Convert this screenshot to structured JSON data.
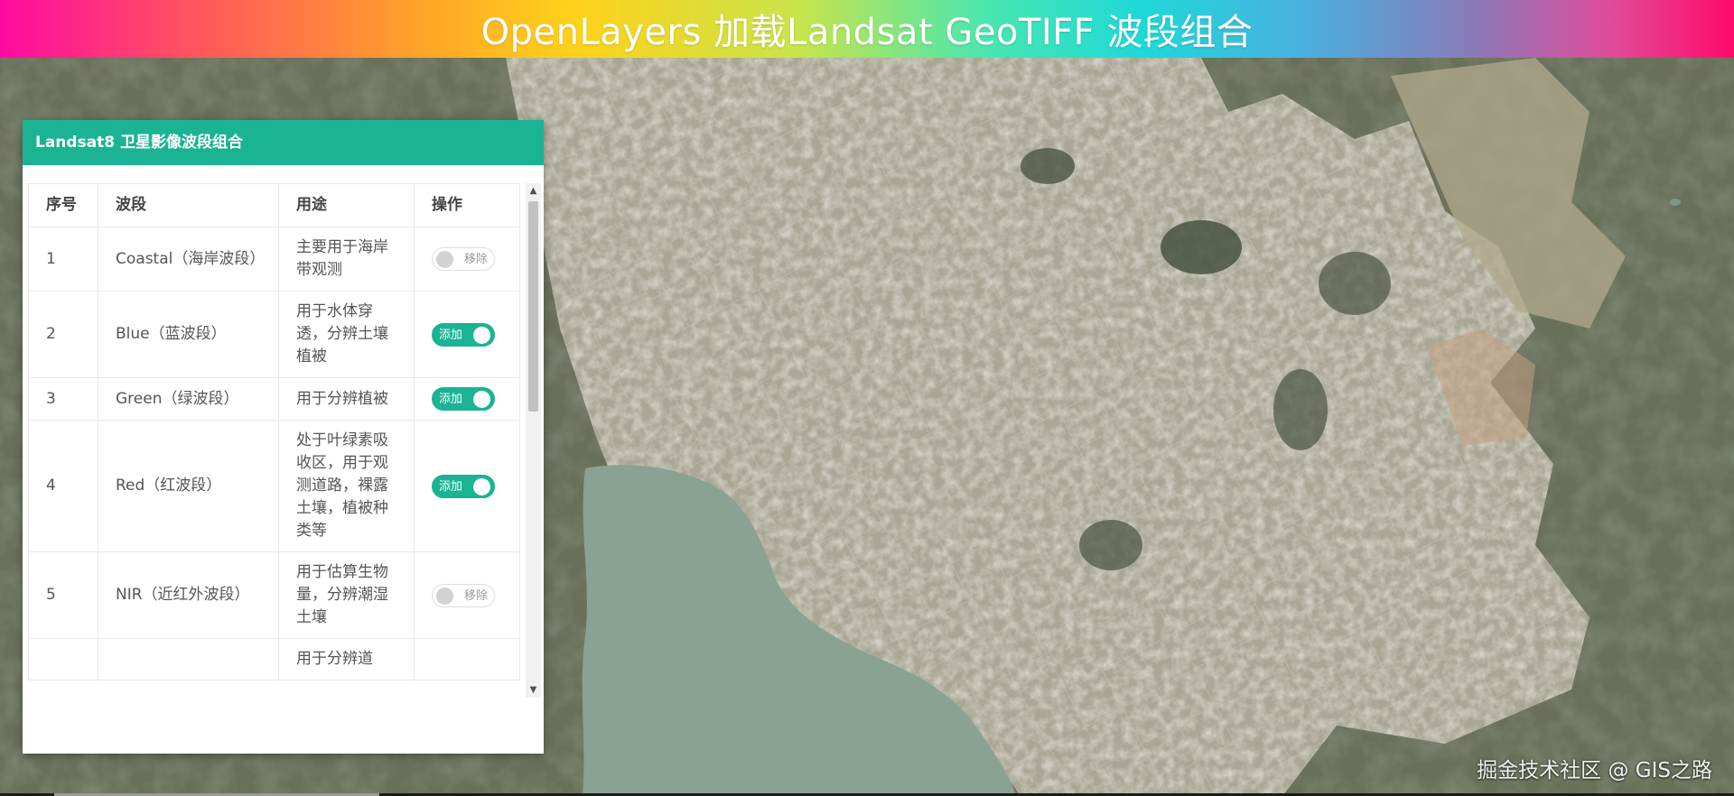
{
  "app": {
    "title": "OpenLayers 加载Landsat GeoTIFF 波段组合",
    "watermark": "掘金技术社区 @ GIS之路"
  },
  "panel": {
    "title": "Landsat8 卫星影像波段组合",
    "columns": [
      "序号",
      "波段",
      "用途",
      "操作"
    ],
    "rows": [
      {
        "index": "1",
        "band": "Coastal（海岸波段）",
        "use": "主要用于海岸带观测",
        "on": false,
        "toggle_label": "移除"
      },
      {
        "index": "2",
        "band": "Blue（蓝波段）",
        "use": "用于水体穿透，分辨土壤植被",
        "on": true,
        "toggle_label": "添加"
      },
      {
        "index": "3",
        "band": "Green（绿波段）",
        "use": "用于分辨植被",
        "on": true,
        "toggle_label": "添加"
      },
      {
        "index": "4",
        "band": "Red（红波段）",
        "use": "处于叶绿素吸收区，用于观测道路，裸露土壤，植被种类等",
        "on": true,
        "toggle_label": "添加"
      },
      {
        "index": "5",
        "band": "NIR（近红外波段）",
        "use": "用于估算生物量，分辨潮湿土壤",
        "on": false,
        "toggle_label": "移除"
      },
      {
        "index": "",
        "band": "",
        "use": "用于分辨道",
        "on": false,
        "toggle_label": ""
      }
    ]
  },
  "colors": {
    "accent": "#1ab394",
    "toggle_off_border": "#dddddd",
    "lake": "#8aa293"
  },
  "icons": {
    "scroll_up": "triangle-up-icon",
    "scroll_down": "triangle-down-icon"
  }
}
